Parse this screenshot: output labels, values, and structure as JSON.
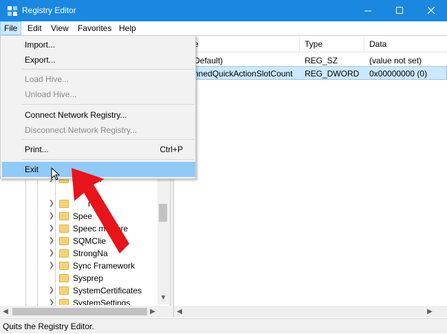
{
  "window": {
    "title": "Registry Editor"
  },
  "menubar": {
    "file": "File",
    "edit": "Edit",
    "view": "View",
    "favorites": "Favorites",
    "help": "Help"
  },
  "file_menu": {
    "import": "Import...",
    "export": "Export...",
    "load_hive": "Load Hive...",
    "unload_hive": "Unload Hive...",
    "connect": "Connect Network Registry...",
    "disconnect": "Disconnect Network Registry...",
    "print": "Print...",
    "print_shortcut": "Ctrl+P",
    "exit": "Exit"
  },
  "list": {
    "columns": {
      "name": "e",
      "type": "Type",
      "data": "Data"
    },
    "rows": [
      {
        "name": "Default)",
        "type": "REG_SZ",
        "data": "(value not set)"
      },
      {
        "name": "nnedQuickActionSlotCount",
        "type": "REG_DWORD",
        "data": "0x00000000 (0)"
      }
    ]
  },
  "tree": {
    "items": [
      {
        "label": "venlight"
      },
      {
        "label": "re"
      },
      {
        "label": "Spee"
      },
      {
        "label": "Speec      meCore"
      },
      {
        "label": "SQMClie"
      },
      {
        "label": "StrongNa"
      },
      {
        "label": "Sync Framework"
      },
      {
        "label": "Sysprep"
      },
      {
        "label": "SystemCertificates"
      },
      {
        "label": "SystemSettings"
      }
    ]
  },
  "status": {
    "text": "Quits the Registry Editor."
  },
  "colors": {
    "titlebar": "#1a88e0",
    "highlight": "#91c9f7",
    "arrow": "#e8141b"
  }
}
